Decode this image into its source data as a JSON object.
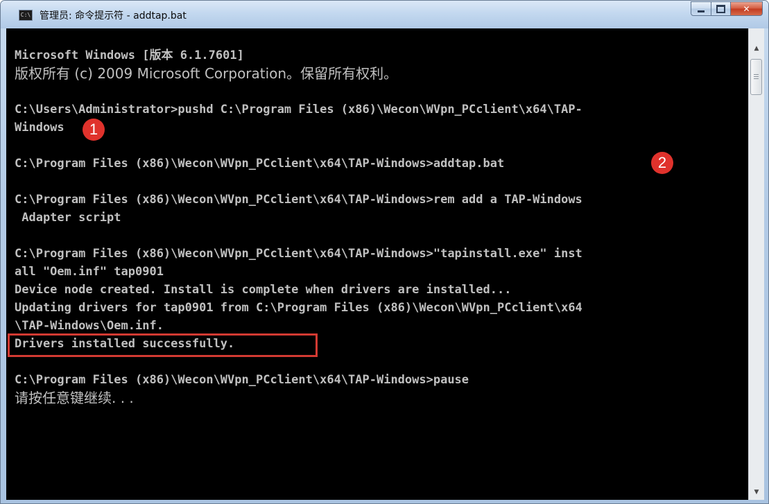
{
  "window": {
    "title": "管理员: 命令提示符 - addtap.bat",
    "icon": "cmd-icon"
  },
  "console": {
    "lines": [
      "Microsoft Windows [版本 6.1.7601]",
      "版权所有 (c) 2009 Microsoft Corporation。保留所有权利。",
      "",
      "C:\\Users\\Administrator>pushd C:\\Program Files (x86)\\Wecon\\WVpn_PCclient\\x64\\TAP-",
      "Windows",
      "",
      "C:\\Program Files (x86)\\Wecon\\WVpn_PCclient\\x64\\TAP-Windows>addtap.bat",
      "",
      "C:\\Program Files (x86)\\Wecon\\WVpn_PCclient\\x64\\TAP-Windows>rem add a TAP-Windows",
      " Adapter script",
      "",
      "C:\\Program Files (x86)\\Wecon\\WVpn_PCclient\\x64\\TAP-Windows>\"tapinstall.exe\" inst",
      "all \"Oem.inf\" tap0901",
      "Device node created. Install is complete when drivers are installed...",
      "Updating drivers for tap0901 from C:\\Program Files (x86)\\Wecon\\WVpn_PCclient\\x64",
      "\\TAP-Windows\\Oem.inf.",
      "Drivers installed successfully.",
      "",
      "C:\\Program Files (x86)\\Wecon\\WVpn_PCclient\\x64\\TAP-Windows>pause",
      "请按任意键继续. . ."
    ]
  },
  "annotations": {
    "badge1": "1",
    "badge2": "2"
  },
  "colors": {
    "console_bg": "#000000",
    "console_text": "#c0c0c0",
    "annotation_red": "#e0322c"
  }
}
